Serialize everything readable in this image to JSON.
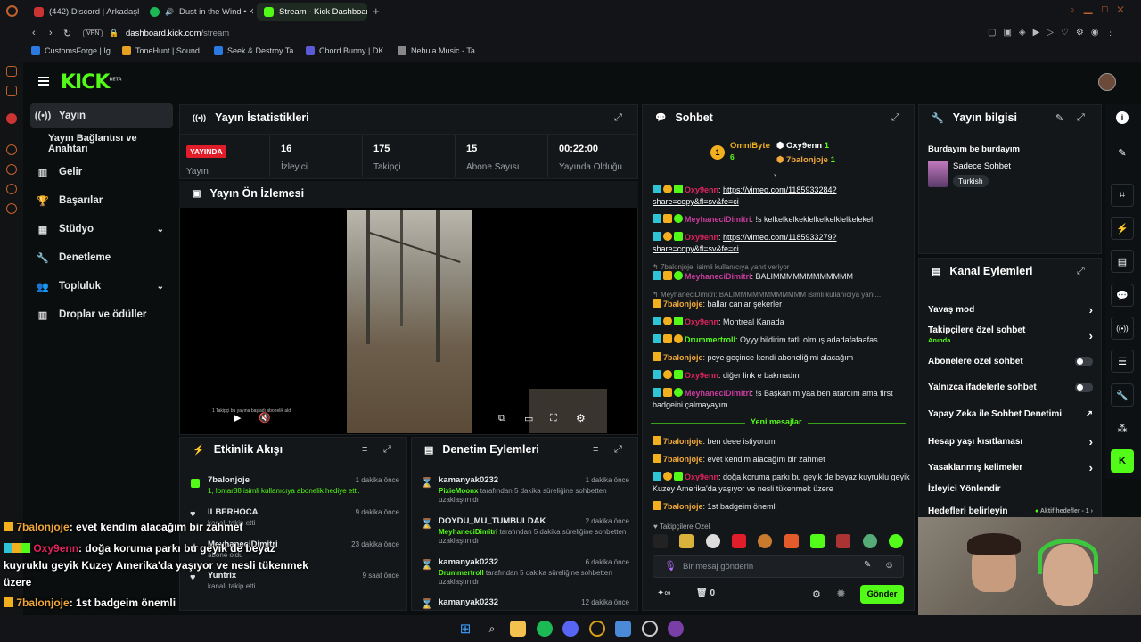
{
  "browser": {
    "tabs": [
      {
        "label": "(442) Discord | Arkadaşlar",
        "color": "#5865f2"
      },
      {
        "label": "Dust in the Wind • Kan",
        "color": "#1db954"
      },
      {
        "label": "Stream - Kick Dashboard",
        "color": "#53fc18"
      }
    ],
    "url_host": "dashboard.kick.com",
    "url_path": "/stream",
    "vpn": "VPN",
    "bookmarks": [
      "CustomsForge | Ig...",
      "ToneHunt | Sound...",
      "Seek & Destroy Ta...",
      "Chord Bunny | DK...",
      "Nebula Music - Ta..."
    ]
  },
  "kick": {
    "logo": "KICK",
    "logo_sup": "BETA"
  },
  "nav": [
    {
      "label": "Yayın",
      "icon": "radio-icon"
    },
    {
      "label": "Yayın Bağlantısı ve Anahtarı",
      "icon": ""
    },
    {
      "label": "Gelir",
      "icon": "chart-icon"
    },
    {
      "label": "Başarılar",
      "icon": "trophy-icon"
    },
    {
      "label": "Stüdyo",
      "icon": "studio-icon"
    },
    {
      "label": "Denetleme",
      "icon": "wrench-icon"
    },
    {
      "label": "Topluluk",
      "icon": "people-icon"
    },
    {
      "label": "Droplar ve ödüller",
      "icon": "chart-icon"
    }
  ],
  "stats": {
    "title": "Yayın İstatistikleri",
    "live": "YAYINDA",
    "items": [
      {
        "value": "",
        "label": "Yayın"
      },
      {
        "value": "16",
        "label": "İzleyici"
      },
      {
        "value": "175",
        "label": "Takipçi"
      },
      {
        "value": "15",
        "label": "Abone Sayısı"
      },
      {
        "value": "00:22:00",
        "label": "Yayında Olduğu"
      }
    ]
  },
  "preview": {
    "title": "Yayın Ön İzlemesi",
    "overlay_text": "1 Takipçi bu yayına başladı abonelik aldı"
  },
  "events": {
    "title": "Etkinlik Akışı",
    "items": [
      {
        "user": "7balonjoje",
        "desc": "1, lomar88 isimli kullanıcıya abonelik hediye etti.",
        "time": "1 dakika önce",
        "icon": "gift"
      },
      {
        "user": "ILBERHOCA",
        "desc": "kanalı takip etti",
        "time": "9 dakika önce",
        "icon": "heart"
      },
      {
        "user": "MeyhaneciDimitri",
        "desc": "abone oldu",
        "time": "23 dakika önce",
        "icon": "star"
      },
      {
        "user": "Yuntrix",
        "desc": "kanalı takip etti",
        "time": "9 saat önce",
        "icon": "heart"
      }
    ]
  },
  "mod": {
    "title": "Denetim Eylemleri",
    "items": [
      {
        "user": "kamanyak0232",
        "target": "PixieMoonx",
        "desc": "tarafından 5 dakika süreliğine sohbetten uzaklaştırıldı",
        "time": "1 dakika önce"
      },
      {
        "user": "DOYDU_MU_TUMBULDAK",
        "target": "MeyhaneciDimitri",
        "desc": "tarafından 5 dakika süreliğine sohbetten uzaklaştırıldı",
        "time": "2 dakika önce"
      },
      {
        "user": "kamanyak0232",
        "target": "Drummertroll",
        "desc": "tarafından 5 dakika süreliğine sohbetten uzaklaştırıldı",
        "time": "6 dakika önce"
      },
      {
        "user": "kamanyak0232",
        "target": "",
        "desc": "",
        "time": "12 dakika önce"
      }
    ]
  },
  "chat": {
    "title": "Sohbet",
    "top": [
      {
        "rank": "1",
        "name": "OmniByte",
        "count": "6"
      },
      {
        "name": "Oxy9enn",
        "count": "1"
      },
      {
        "name": "7balonjoje",
        "count": "1"
      }
    ],
    "messages": [
      {
        "user": "Oxy9enn",
        "color": "#e0245e",
        "text": "https://vimeo.com/1185933284?share=copy&fl=sv&fe=ci",
        "link": true
      },
      {
        "user": "MeyhaneciDimitri",
        "color": "#c93c9e",
        "text": "!s kelkelkelkeklelkelkelklelkelekel"
      },
      {
        "user": "Oxy9enn",
        "color": "#e0245e",
        "text": "https://vimeo.com/1185933279?share=copy&fl=sv&fe=ci",
        "link": true
      },
      {
        "reply": "7balonjoje: isimli kullanıcıya yanıt veriyor",
        "user": "MeyhaneciDimitri",
        "color": "#c93c9e",
        "text": "BALIMMMMMMMMMMMM"
      },
      {
        "reply": "MeyhaneciDimitri: BALIMMMMMMMMMMMM isimli kullanıcıya yanı...",
        "user": "7balonjoje",
        "color": "#f2a93b",
        "text": "ballar canlar şekerler"
      },
      {
        "user": "Oxy9enn",
        "color": "#e0245e",
        "text": "Montreal Kanada"
      },
      {
        "user": "Drummertroll",
        "color": "#53fc18",
        "text": "Oyyy bildirim tatlı olmuş adadafafaafas"
      },
      {
        "user": "7balonjoje",
        "color": "#f2a93b",
        "text": "pcye geçince kendi aboneliğimi alacağım"
      },
      {
        "user": "Oxy9enn",
        "color": "#e0245e",
        "text": "diğer link e bakmadın"
      },
      {
        "user": "MeyhaneciDimitri",
        "color": "#c93c9e",
        "text": "!s Başkanım yaa ben atardım ama first badgeini çalmayayım"
      }
    ],
    "new_label": "Yeni mesajlar",
    "new_messages": [
      {
        "user": "7balonjoje",
        "color": "#f2a93b",
        "text": "ben deee istiyorum"
      },
      {
        "user": "7balonjoje",
        "color": "#f2a93b",
        "text": "evet kendim alacağım bir zahmet"
      },
      {
        "user": "Oxy9enn",
        "color": "#e0245e",
        "text": "doğa koruma parkı bu geyik de beyaz kuyruklu geyik Kuzey Amerika'da yaşıyor ve nesli tükenmek üzere"
      },
      {
        "user": "7balonjoje",
        "color": "#f2a93b",
        "text": "1st badgeim önemli"
      }
    ],
    "followers_label": "Takipçilere Özel",
    "input_placeholder": "Bir mesaj gönderin",
    "points": "0",
    "send_label": "Gönder"
  },
  "info": {
    "title": "Yayın bilgisi",
    "stream_title": "Burdayım be burdayım",
    "category": "Sadece Sohbet",
    "tag": "Turkish"
  },
  "actions": {
    "title": "Kanal Eylemleri",
    "items": [
      {
        "label": "Yavaş mod",
        "type": "chevron"
      },
      {
        "label": "Takipçilere özel sohbet",
        "sub": "Anında",
        "type": "chevron"
      },
      {
        "label": "Abonelere özel sohbet",
        "type": "toggle"
      },
      {
        "label": "Yalnızca ifadelerle sohbet",
        "type": "toggle"
      },
      {
        "label": "Yapay Zeka ile Sohbet Denetimi",
        "type": "ext"
      },
      {
        "label": "Hesap yaşı kısıtlaması",
        "type": "chevron"
      },
      {
        "label": "Yasaklanmış kelimeler",
        "type": "chevron"
      },
      {
        "label": "İzleyici Yönlendir",
        "type": "none"
      },
      {
        "label": "Hedefleri belirleyin",
        "sub": "Aktif hedefler - 1",
        "type": "chevron"
      }
    ]
  },
  "overlay": [
    {
      "user": "7balonjoje",
      "color": "#f2a93b",
      "text": ": evet kendim alacağım bir zahmet"
    },
    {
      "user": "Oxy9enn",
      "color": "#e0245e",
      "text": ": doğa koruma parkı bu geyik de beyaz"
    },
    {
      "user": "",
      "color": "#fff",
      "text": "kuyruklu geyik Kuzey Amerika'da yaşıyor ve nesli tükenmek"
    },
    {
      "user": "",
      "color": "#fff",
      "text": "üzere"
    },
    {
      "user": "7balonjoje",
      "color": "#f2a93b",
      "text": ": 1st badgeim önemli"
    }
  ],
  "colors": {
    "accent": "#53fc18",
    "live": "#e11d2a"
  }
}
